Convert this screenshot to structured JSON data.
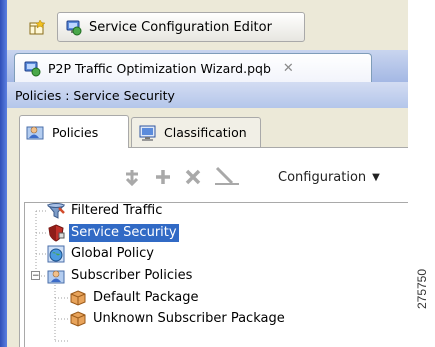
{
  "window": {
    "perspective_icon": "perspective-icon",
    "editor_button": {
      "label": "Service Configuration Editor",
      "icon": "service-config-editor-icon"
    }
  },
  "editor_tab": {
    "title": "P2P Traffic Optimization Wizard.pqb",
    "icon": "editor-file-icon",
    "close_icon": "close-icon"
  },
  "breadcrumb": "Policies : Service Security",
  "tabs": [
    {
      "label": "Policies",
      "icon": "policies-icon",
      "active": true
    },
    {
      "label": "Classification",
      "icon": "classification-icon",
      "active": false
    }
  ],
  "panel_toolbar": {
    "icons": [
      "add-child-icon",
      "add-icon",
      "delete-icon",
      "edit-icon"
    ],
    "configuration_label": "Configuration",
    "dropdown_icon": "chevron-down-icon"
  },
  "tree": [
    {
      "label": "Filtered Traffic",
      "icon": "filter-funnel-icon",
      "level": 0,
      "selected": false
    },
    {
      "label": "Service Security",
      "icon": "shield-icon",
      "level": 0,
      "selected": true
    },
    {
      "label": "Global Policy",
      "icon": "globe-icon",
      "level": 0,
      "selected": false
    },
    {
      "label": "Subscriber Policies",
      "icon": "subscriber-icon",
      "level": 0,
      "selected": false,
      "expanded": true
    },
    {
      "label": "Default Package",
      "icon": "package-icon",
      "level": 1,
      "selected": false
    },
    {
      "label": "Unknown Subscriber Package",
      "icon": "package-icon",
      "level": 1,
      "selected": false
    }
  ],
  "figure_id": "275750",
  "colors": {
    "selection": "#316ac5",
    "header_blue": "#a4b8e4",
    "window_bg": "#ece9d8"
  }
}
